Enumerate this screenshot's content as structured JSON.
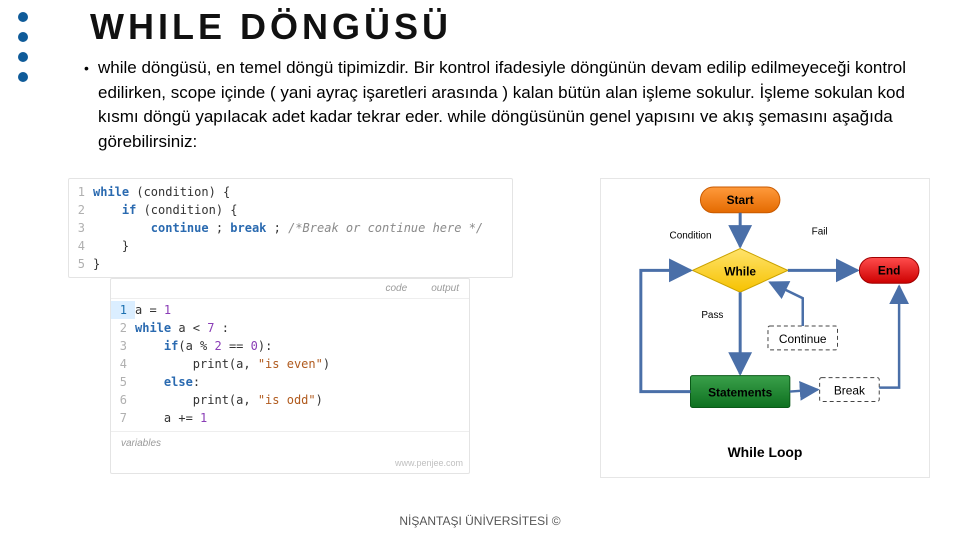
{
  "title": "WHILE DÖNGÜSÜ",
  "paragraph": "while döngüsü, en temel döngü tipimizdir. Bir kontrol ifadesiyle döngünün devam edilip edilmeyeceği kontrol edilirken, scope içinde ( yani ayraç işaretleri arasında ) kalan bütün alan işleme sokulur. İşleme sokulan kod kısmı döngü yapılacak adet kadar tekrar eder. while döngüsünün genel yapısını ve akış şemasını aşağıda görebilirsiniz:",
  "code1": {
    "lines": [
      {
        "n": "1",
        "kw": "while",
        "mid": " (condition) {"
      },
      {
        "n": "2",
        "kw": "if",
        "mid": " (condition) {",
        "indent": "    "
      },
      {
        "n": "3",
        "kw": "continue",
        "mid": " ; ",
        "kw2": "break",
        "tail": " ; ",
        "comment": "/*Break or continue here */",
        "indent": "        "
      },
      {
        "n": "4",
        "plain": "    }"
      },
      {
        "n": "5",
        "plain": "}"
      }
    ]
  },
  "code2": {
    "tabs": [
      "code",
      "output"
    ],
    "footer": "variables",
    "watermark": "www.penjee.com",
    "lines": [
      {
        "n": "1",
        "active": true,
        "src": "a = ",
        "num": "1"
      },
      {
        "n": "2",
        "kw": "while",
        "src2": " a < ",
        "num": "7",
        "tail": " :"
      },
      {
        "n": "3",
        "indent": "    ",
        "kw": "if",
        "src2": "(a % ",
        "num": "2",
        "src3": " == ",
        "num2": "0",
        "tail": "):"
      },
      {
        "n": "4",
        "indent": "        ",
        "fn": "print",
        "src2": "(a, ",
        "str": "\"is even\"",
        "tail": ")"
      },
      {
        "n": "5",
        "indent": "    ",
        "kw": "else",
        "tail": ":"
      },
      {
        "n": "6",
        "indent": "        ",
        "fn": "print",
        "src2": "(a, ",
        "str": "\"is odd\"",
        "tail": ")"
      },
      {
        "n": "7",
        "indent": "    ",
        "src": "a += ",
        "num": "1"
      }
    ]
  },
  "diagram": {
    "start": "Start",
    "while": "While",
    "statements": "Statements",
    "end": "End",
    "continue": "Continue",
    "break": "Break",
    "condition": "Condition",
    "pass": "Pass",
    "fail": "Fail",
    "caption": "While Loop"
  },
  "footer": "NİŞANTAŞI ÜNİVERSİTESİ ©"
}
